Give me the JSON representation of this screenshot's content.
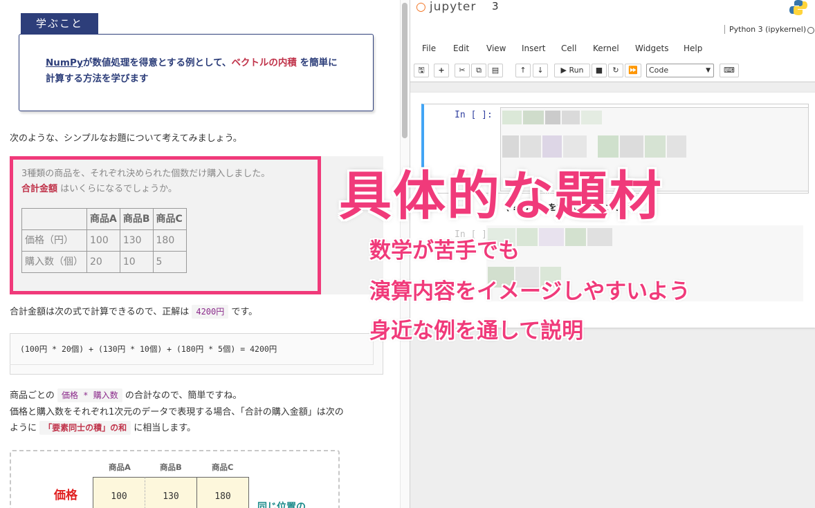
{
  "lesson": {
    "learn_tab": "学ぶこと",
    "learn_parts": [
      "NumPy",
      "が数値処理を得意とする例として、",
      "ベクトルの内積",
      " を簡単に",
      "計算する方法を学びます"
    ],
    "intro": "次のような、シンプルなお題について考えてみましょう。",
    "problem_line1": "3種類の商品を、それぞれ決められた個数だけ購入しました。",
    "problem_total": "合計金額",
    "problem_line2_rest": " はいくらになるでしょうか。",
    "table_headers": [
      "",
      "商品A",
      "商品B",
      "商品C"
    ],
    "table_rows": [
      [
        "価格（円）",
        "100",
        "130",
        "180"
      ],
      [
        "購入数（個）",
        "20",
        "10",
        "5"
      ]
    ],
    "answer_pre": "合計金額は次の式で計算できるので、正解は ",
    "answer_value": "4200円",
    "answer_post": " です。",
    "formula": "(100円 * 20個) + (130円 * 10個) + (180円 * 5個) = 4200円",
    "para2_pre": "商品ごとの ",
    "para2_code": "価格 * 購入数",
    "para2_post": " の合計なので、簡単ですね。",
    "para3": "価格と購入数をそれぞれ1次元のデータで表現する場合、「合計の購入金額」は次の",
    "para4_pre": "ように ",
    "para4_red": "「要素同士の積」の和",
    "para4_post": " に相当します。",
    "diagram_headers": [
      "商品A",
      "商品B",
      "商品C"
    ],
    "diagram_row_label": "価格",
    "diagram_values": [
      "100",
      "130",
      "180"
    ],
    "diagram_side": "同じ位置の"
  },
  "jupyter": {
    "logo": "jupyter",
    "notebook_title": "3",
    "kernel": "Python 3 (ipykernel)",
    "menu": [
      "File",
      "Edit",
      "View",
      "Insert",
      "Cell",
      "Kernel",
      "Widgets",
      "Help"
    ],
    "run_label": "Run",
    "cell_type": "Code",
    "prompt1": "In [ ]:",
    "prompt2": "In [ ]:",
    "md_text": "( ??  )  部分を穴埋めしてください)"
  },
  "overlay": {
    "title": "具体的な題材",
    "line1": "数学が苦手でも",
    "line2": "演算内容をイメージしやすいよう",
    "line3": "身近な例を通して説明"
  },
  "colors": {
    "accent_pink": "#f03a7a",
    "navy": "#2d3e7a",
    "highlight_red": "#c0334a",
    "jupyter_orange": "#f37626",
    "cell_blue": "#42a5f5"
  }
}
